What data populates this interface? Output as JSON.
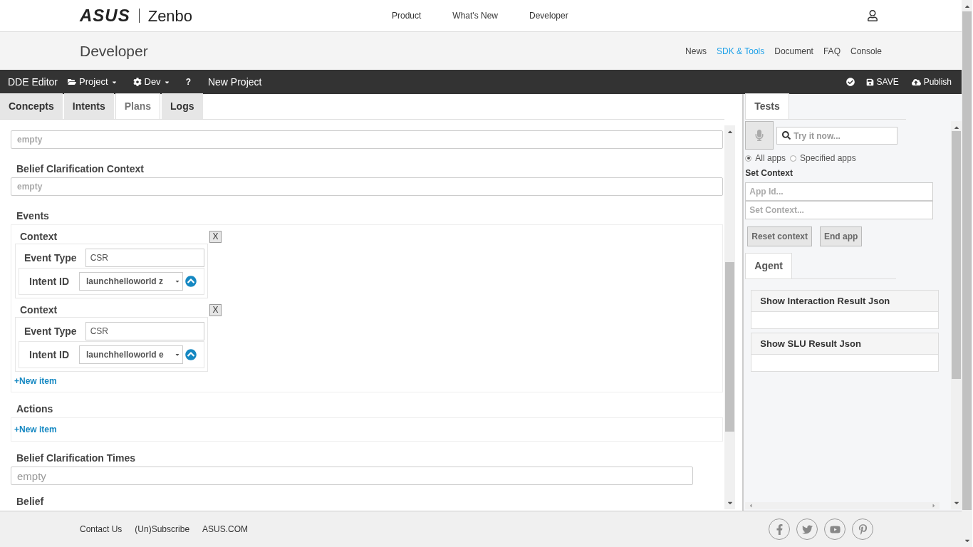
{
  "header": {
    "logo": "ASUS",
    "product": "Zenbo",
    "nav": [
      "Product",
      "What's New",
      "Developer"
    ]
  },
  "subheader": {
    "title": "Developer",
    "links": [
      {
        "label": "News",
        "selected": false
      },
      {
        "label": "SDK & Tools",
        "selected": true
      },
      {
        "label": "Document",
        "selected": false
      },
      {
        "label": "FAQ",
        "selected": false
      },
      {
        "label": "Console",
        "selected": false
      }
    ]
  },
  "toolbar": {
    "app": "DDE Editor",
    "menus": [
      {
        "kind": "folder",
        "label": "Project"
      },
      {
        "kind": "gear",
        "label": "Dev"
      }
    ],
    "help": "?",
    "project": "New Project",
    "save": "SAVE",
    "publish": "Publish"
  },
  "editor": {
    "tabs": [
      {
        "label": "Concepts",
        "selected": false
      },
      {
        "label": "Intents",
        "selected": false
      },
      {
        "label": "Plans",
        "selected": true
      },
      {
        "label": "Logs",
        "selected": false
      }
    ],
    "top_field": {
      "placeholder": "empty"
    },
    "belief_context": {
      "label": "Belief Clarification Context",
      "placeholder": "empty"
    },
    "events": {
      "label": "Events",
      "items": [
        {
          "title": "Context",
          "remove": "X",
          "event_type_label": "Event Type",
          "event_type": "CSR",
          "intent_label": "Intent ID",
          "intent": "launchhelloworld z"
        },
        {
          "title": "Context",
          "remove": "X",
          "event_type_label": "Event Type",
          "event_type": "CSR",
          "intent_label": "Intent ID",
          "intent": "launchhelloworld e"
        }
      ],
      "add": "+New item"
    },
    "actions": {
      "label": "Actions",
      "add": "+New item"
    },
    "belief_times": {
      "label": "Belief Clarification Times",
      "placeholder": "empty"
    },
    "belief": {
      "label": "Belief"
    }
  },
  "tests": {
    "tab": "Tests",
    "search_placeholder": "Try it now...",
    "scope": [
      {
        "label": "All apps",
        "selected": true
      },
      {
        "label": "Specified apps",
        "selected": false
      }
    ],
    "context_heading": "Set Context",
    "app_id_placeholder": "App Id...",
    "context_placeholder": "Set Context...",
    "buttons": [
      "Reset context",
      "End app"
    ],
    "agent_tab": "Agent",
    "panels": [
      "Show Interaction Result Json",
      "Show SLU Result Json"
    ]
  },
  "footer": {
    "links": [
      "Contact Us",
      "(Un)Subscribe",
      "ASUS.COM"
    ]
  }
}
